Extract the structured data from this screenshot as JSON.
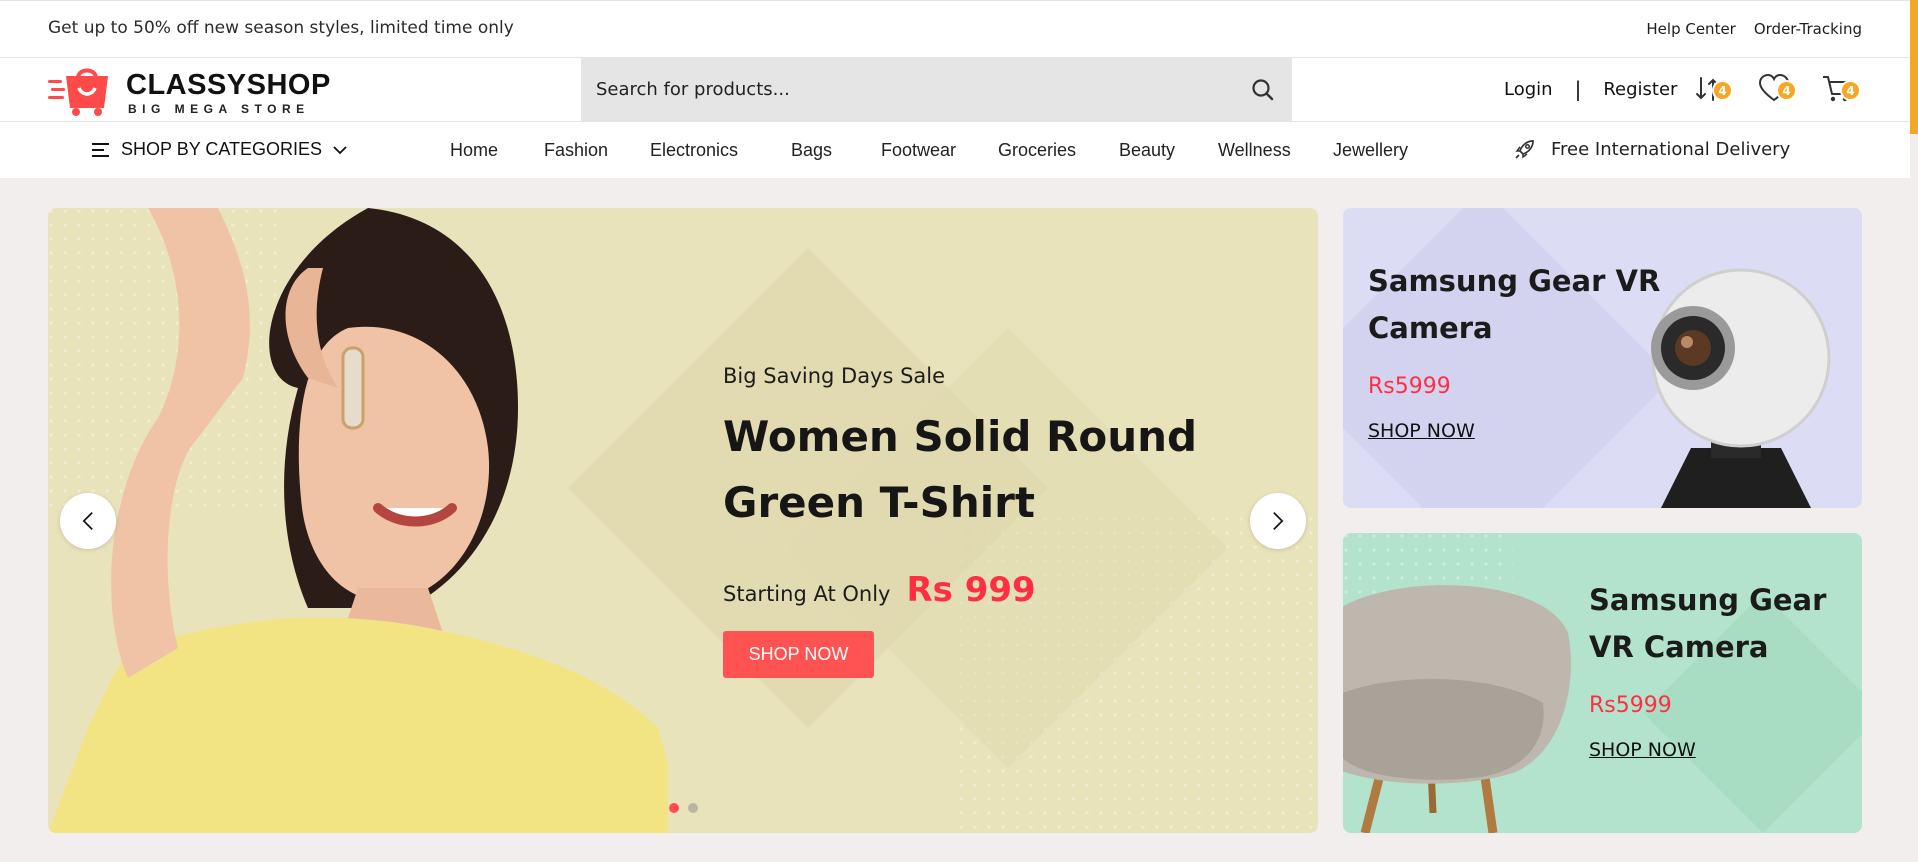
{
  "topbar": {
    "promo": "Get up to 50% off new season styles, limited time only",
    "help_center": "Help Center",
    "order_tracking": "Order-Tracking"
  },
  "header": {
    "brand": "CLASSYSHOP",
    "tagline": "BIG MEGA STORE",
    "search_placeholder": "Search for products...",
    "login": "Login",
    "separator": "|",
    "register": "Register",
    "compare_count": "4",
    "wishlist_count": "4",
    "cart_count": "4"
  },
  "nav": {
    "categories_label": "SHOP BY CATEGORIES",
    "items": [
      "Home",
      "Fashion",
      "Electronics",
      "Bags",
      "Footwear",
      "Groceries",
      "Beauty",
      "Wellness",
      "Jewellery"
    ],
    "delivery": "Free International Delivery"
  },
  "hero": {
    "eyebrow": "Big Saving Days Sale",
    "title": "Women Solid Round Green T-Shirt",
    "starting": "Starting At Only",
    "price": "Rs 999",
    "cta": "SHOP NOW",
    "slide_count": 2,
    "active_slide": 1
  },
  "banners": [
    {
      "title_line1": "Samsung Gear VR",
      "title_line2": "Camera",
      "price": "Rs5999",
      "cta": "SHOP NOW"
    },
    {
      "title_line1": "Samsung Gear",
      "title_line2": "VR Camera",
      "price": "Rs5999",
      "cta": "SHOP NOW"
    }
  ],
  "colors": {
    "accent": "#ff5252",
    "price": "#ff2f43",
    "badge": "#f5a623",
    "hero_bg": "#e9e3bc",
    "banner1_bg": "#dcdcf4",
    "banner2_bg": "#b3e3cd"
  },
  "icons": [
    "search-icon",
    "compare-icon",
    "heart-icon",
    "cart-icon",
    "menu-icon",
    "chevron-down-icon",
    "rocket-icon",
    "chevron-left-icon",
    "chevron-right-icon"
  ]
}
